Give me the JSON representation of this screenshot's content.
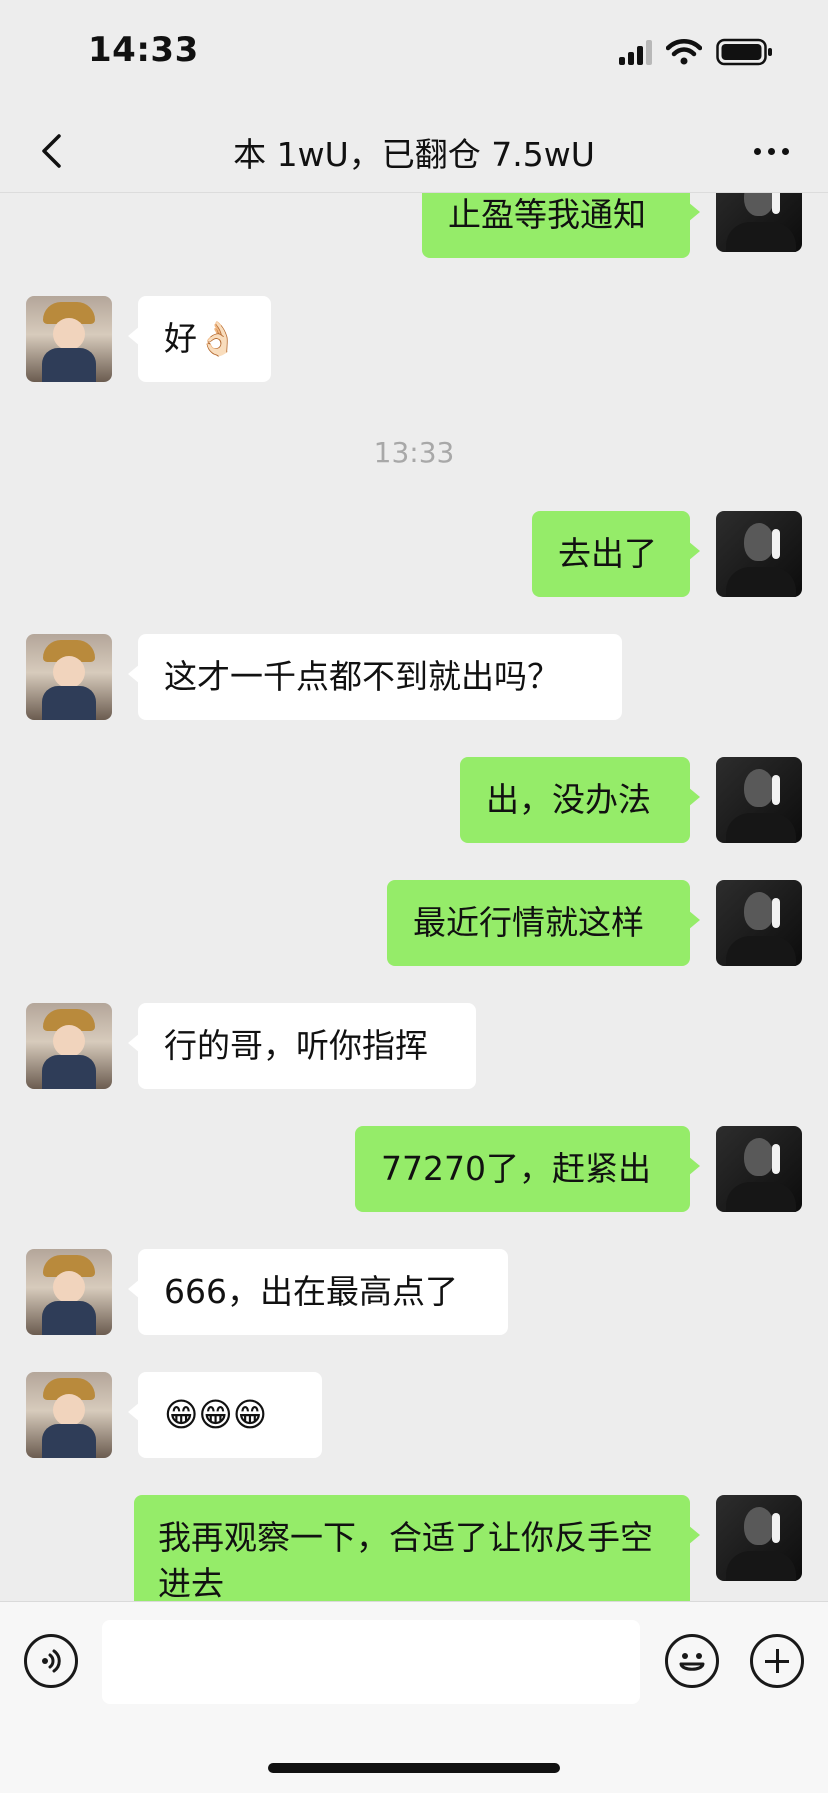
{
  "status_bar": {
    "time": "14:33"
  },
  "nav": {
    "title": "本 1wU，已翻仓 7.5wU"
  },
  "messages": [
    {
      "side": "right",
      "text": "止盈等我通知"
    },
    {
      "side": "left",
      "text": "好👌🏻"
    },
    {
      "type": "timestamp",
      "text": "13:33"
    },
    {
      "side": "right",
      "text": "去出了"
    },
    {
      "side": "left",
      "text": "这才一千点都不到就出吗？"
    },
    {
      "side": "right",
      "text": "出，没办法"
    },
    {
      "side": "right",
      "text": "最近行情就这样"
    },
    {
      "side": "left",
      "text": "行的哥，听你指挥"
    },
    {
      "side": "right",
      "text": "77270了，赶紧出"
    },
    {
      "side": "left",
      "text": "666，出在最高点了"
    },
    {
      "side": "left",
      "text": "😁😁😁"
    },
    {
      "side": "right",
      "text": "我再观察一下，合适了让你反手空进去"
    }
  ],
  "input_bar": {
    "placeholder": "",
    "value": ""
  },
  "icons": {
    "back": "chevron-left-icon",
    "more": "more-dots-icon",
    "voice": "voice-icon",
    "emoji": "emoji-icon",
    "plus": "plus-icon"
  },
  "colors": {
    "background": "#ededed",
    "incoming_bubble": "#ffffff",
    "outgoing_bubble": "#95ec69",
    "timestamp": "#a8a8a8"
  }
}
